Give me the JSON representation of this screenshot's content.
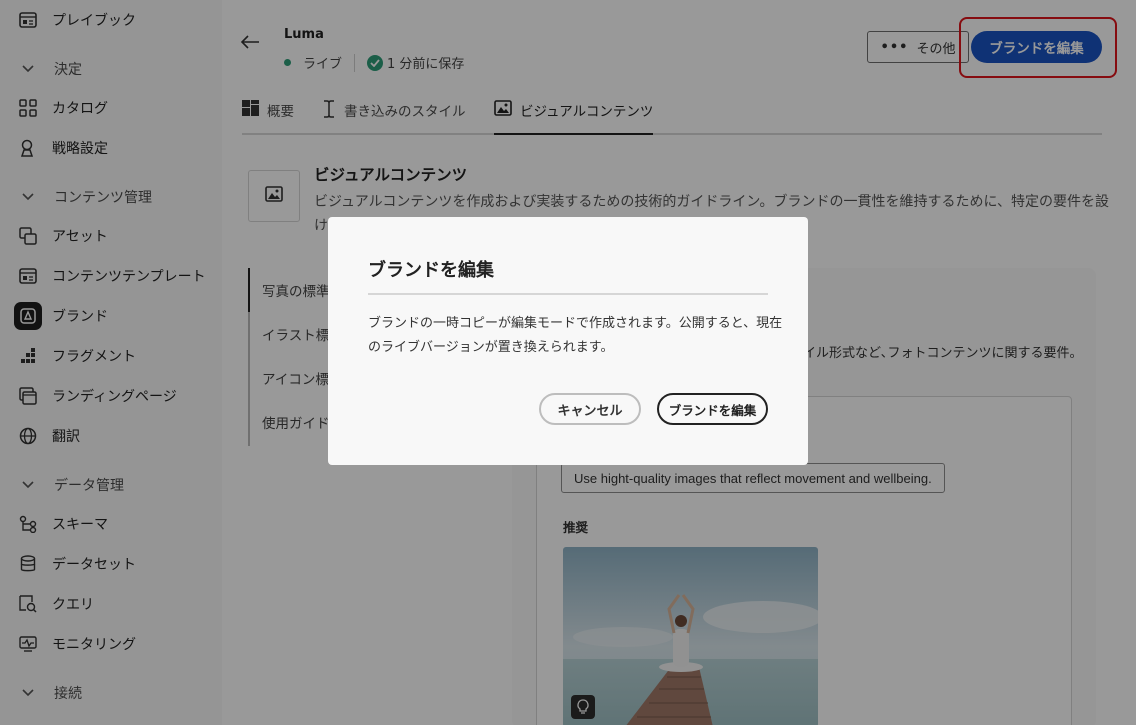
{
  "sidebar": {
    "items": [
      {
        "label": "プレイブック",
        "icon": "playbook-icon"
      },
      {
        "label": "カタログ",
        "icon": "catalog-icon"
      },
      {
        "label": "戦略設定",
        "icon": "strategy-icon"
      },
      {
        "label": "アセット",
        "icon": "assets-icon"
      },
      {
        "label": "コンテンツテンプレート",
        "icon": "template-icon"
      },
      {
        "label": "ブランド",
        "icon": "brand-icon"
      },
      {
        "label": "フラグメント",
        "icon": "fragment-icon"
      },
      {
        "label": "ランディングページ",
        "icon": "landing-page-icon"
      },
      {
        "label": "翻訳",
        "icon": "translate-icon"
      },
      {
        "label": "スキーマ",
        "icon": "schema-icon"
      },
      {
        "label": "データセット",
        "icon": "dataset-icon"
      },
      {
        "label": "クエリ",
        "icon": "query-icon"
      },
      {
        "label": "モニタリング",
        "icon": "monitoring-icon"
      }
    ],
    "sections": [
      {
        "label": "決定"
      },
      {
        "label": "コンテンツ管理"
      },
      {
        "label": "データ管理"
      },
      {
        "label": "接続"
      }
    ]
  },
  "header": {
    "brand_name": "Luma",
    "status": "ライブ",
    "saved": "1 分前に保存",
    "more_label": "その他",
    "edit_label": "ブランドを編集"
  },
  "tabs": [
    {
      "label": "概要"
    },
    {
      "label": "書き込みのスタイル"
    },
    {
      "label": "ビジュアルコンテンツ"
    }
  ],
  "section": {
    "title": "ビジュアルコンテンツ",
    "description": "ビジュアルコンテンツを作成および実装するための技術的ガイドライン。ブランドの一貫性を維持するために、特定の要件を設けています。"
  },
  "subnav": [
    {
      "label": "写真の標準"
    },
    {
      "label": "イラスト標準"
    },
    {
      "label": "アイコン標準"
    },
    {
      "label": "使用ガイド"
    }
  ],
  "content": {
    "description_tail": "ァイル形式など､フォトコンテンツに関する要件。",
    "guideline": "Use hight-quality images that reflect movement and wellbeing.",
    "recommended_label": "推奨"
  },
  "dialog": {
    "title": "ブランドを編集",
    "body": "ブランドの一時コピーが編集モードで作成されます。公開すると、現在のライブバージョンが置き換えられます。",
    "cancel_label": "キャンセル",
    "confirm_label": "ブランドを編集"
  },
  "colors": {
    "accent": "#1a54c4",
    "highlight": "#e0151b",
    "live": "#2d9d78"
  }
}
